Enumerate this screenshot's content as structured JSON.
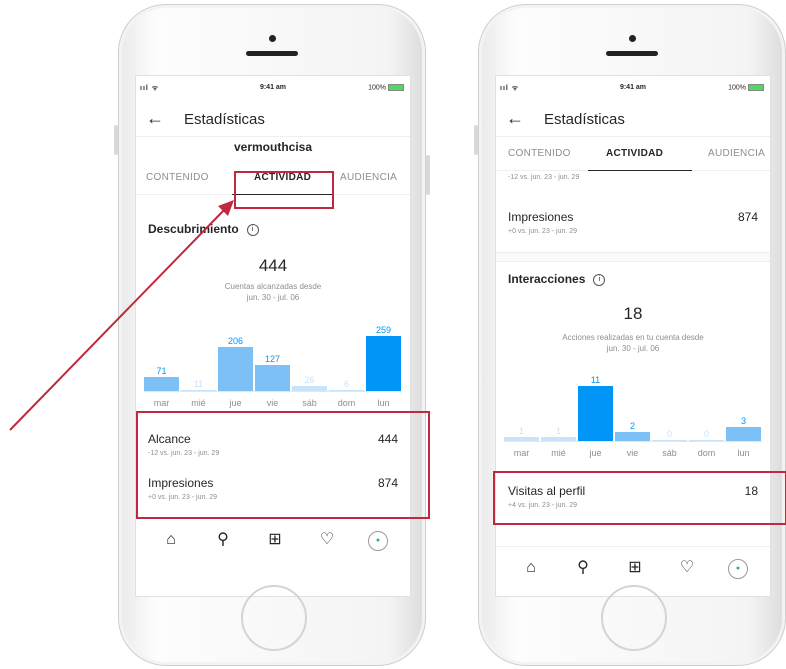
{
  "colors": {
    "bar_dark": "#0095f6",
    "bar_light": "#7cc0f5",
    "bar_pale": "#c9e3fa",
    "highlight": "#c0283e"
  },
  "status": {
    "signal": "ııl ᯤ",
    "time": "9:41 am",
    "battery": "100%"
  },
  "header": {
    "back_icon": "arrow-left-icon",
    "title": "Estadísticas"
  },
  "phone1": {
    "username": "vermouthcisa",
    "tabs": [
      "CONTENIDO",
      "ACTIVIDAD",
      "AUDIENCIA"
    ],
    "section": "Descubrimiento",
    "total": "444",
    "caption1": "Cuentas alcanzadas desde",
    "caption2": "jun. 30 - jul. 06",
    "bars": [
      {
        "day": "mar",
        "value": "71",
        "num": 71
      },
      {
        "day": "mié",
        "value": "11",
        "num": 11
      },
      {
        "day": "jue",
        "value": "206",
        "num": 206
      },
      {
        "day": "vie",
        "value": "127",
        "num": 127
      },
      {
        "day": "sáb",
        "value": "26",
        "num": 26
      },
      {
        "day": "dom",
        "value": "6",
        "num": 6
      },
      {
        "day": "lun",
        "value": "259",
        "num": 259
      }
    ],
    "stats": [
      {
        "name": "Alcance",
        "value": "444",
        "sub": "-12 vs. jun. 23 - jun. 29"
      },
      {
        "name": "Impresiones",
        "value": "874",
        "sub": "+0 vs. jun. 23 - jun. 29"
      }
    ]
  },
  "phone2": {
    "tabs": [
      "CONTENIDO",
      "ACTIVIDAD",
      "AUDIENCIA"
    ],
    "prev_sub": "-12 vs. jun. 23 - jun. 29",
    "impresiones": {
      "name": "Impresiones",
      "value": "874",
      "sub": "+0 vs. jun. 23 - jun. 29"
    },
    "section": "Interacciones",
    "total": "18",
    "caption1": "Acciones realizadas en tu cuenta desde",
    "caption2": "jun. 30 - jul. 06",
    "bars": [
      {
        "day": "mar",
        "value": "1",
        "num": 1
      },
      {
        "day": "mié",
        "value": "1",
        "num": 1
      },
      {
        "day": "jue",
        "value": "11",
        "num": 11
      },
      {
        "day": "vie",
        "value": "2",
        "num": 2
      },
      {
        "day": "sáb",
        "value": "0",
        "num": 0
      },
      {
        "day": "dom",
        "value": "0",
        "num": 0
      },
      {
        "day": "lun",
        "value": "3",
        "num": 3
      }
    ],
    "visitas": {
      "name": "Visitas al perfil",
      "value": "18",
      "sub": "+4 vs. jun. 23 - jun. 29"
    }
  },
  "nav_icons": [
    "home-icon",
    "search-icon",
    "add-icon",
    "heart-icon",
    "profile-icon"
  ],
  "info_glyph": "i"
}
